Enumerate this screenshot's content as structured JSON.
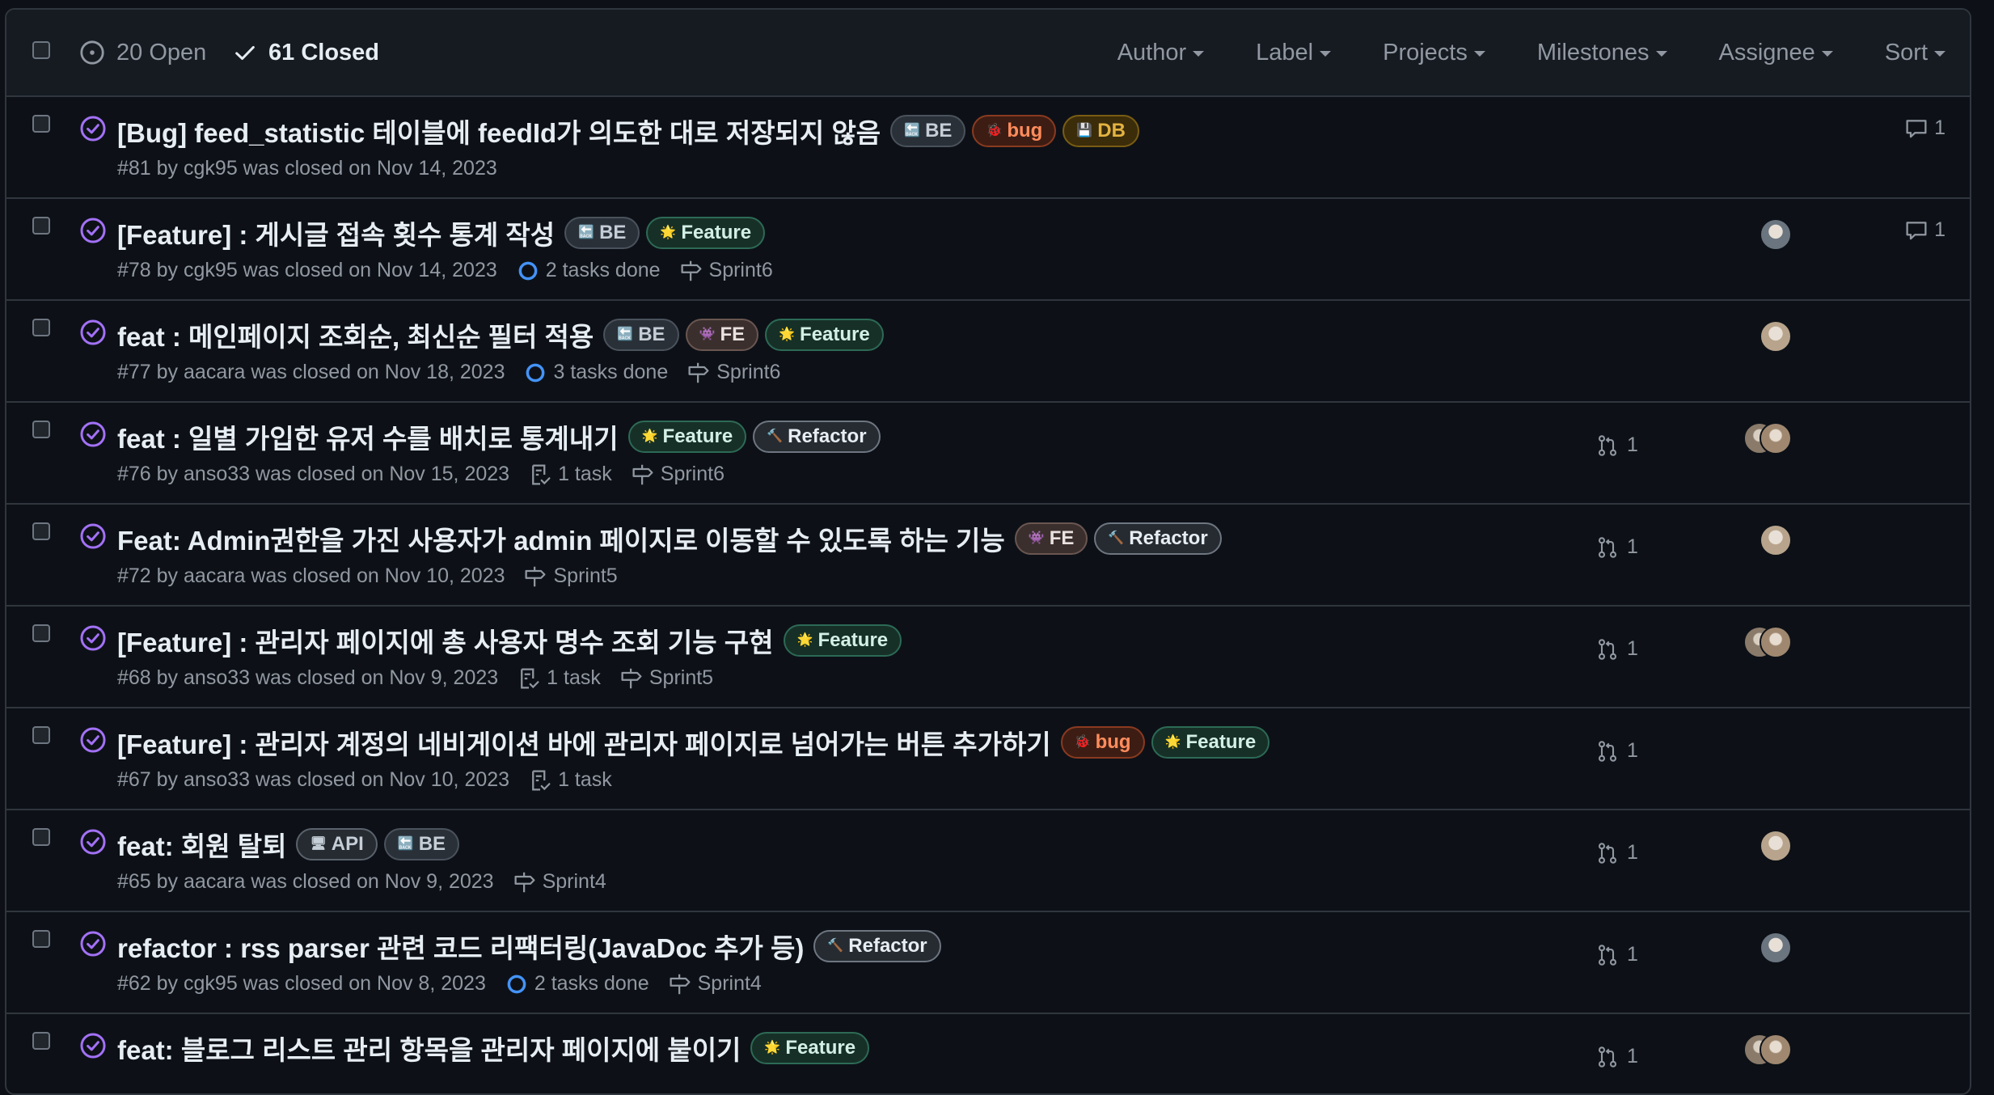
{
  "header": {
    "open_label": "20 Open",
    "closed_label": "61 Closed",
    "filters": [
      "Author",
      "Label",
      "Projects",
      "Milestones",
      "Assignee",
      "Sort"
    ]
  },
  "label_styles": {
    "BE": {
      "color": "#c5cdd6",
      "bg": "#2a3038",
      "border": "#4a525c",
      "icon": "🔙"
    },
    "FE": {
      "color": "#e9e2e0",
      "bg": "#3a2f2d",
      "border": "#6a5651",
      "icon": "👾"
    },
    "bug": {
      "color": "#ff8c5c",
      "bg": "#3d1d13",
      "border": "#8a3a20",
      "icon": "🐞"
    },
    "DB": {
      "color": "#e3b341",
      "bg": "#3b2c0a",
      "border": "#7a5d14",
      "icon": "💾"
    },
    "Feature": {
      "color": "#d3f0e6",
      "bg": "#173027",
      "border": "#2d6a55",
      "icon": "🌟"
    },
    "Refactor": {
      "color": "#e6edf3",
      "bg": "#262b31",
      "border": "#6e7681",
      "icon": "🔨"
    },
    "API": {
      "color": "#c5cdd6",
      "bg": "#262b31",
      "border": "#5a626c",
      "icon": "🖥"
    }
  },
  "issues": [
    {
      "title": "[Bug] feed_statistic 테이블에 feedId가 의도한 대로 저장되지 않음",
      "labels": [
        "BE",
        "bug",
        "DB"
      ],
      "meta": "#81 by cgk95 was closed on Nov 14, 2023",
      "tasks": "",
      "task_type": "",
      "milestone": "",
      "prs": "",
      "avatars": [],
      "comments": "1"
    },
    {
      "title": "[Feature] : 게시글 접속 횟수 통계 작성",
      "labels": [
        "BE",
        "Feature"
      ],
      "meta": "#78 by cgk95 was closed on Nov 14, 2023",
      "tasks": "2 tasks done",
      "task_type": "circle",
      "milestone": "Sprint6",
      "prs": "",
      "avatars": [
        "#6a7580"
      ],
      "comments": "1"
    },
    {
      "title": "feat : 메인페이지 조회순, 최신순 필터 적용",
      "labels": [
        "BE",
        "FE",
        "Feature"
      ],
      "meta": "#77 by aacara was closed on Nov 18, 2023",
      "tasks": "3 tasks done",
      "task_type": "circle",
      "milestone": "Sprint6",
      "prs": "",
      "avatars": [
        "#b8a48c"
      ],
      "comments": ""
    },
    {
      "title": "feat : 일별 가입한 유저 수를 배치로 통계내기",
      "labels": [
        "Feature",
        "Refactor"
      ],
      "meta": "#76 by anso33 was closed on Nov 15, 2023",
      "tasks": "1 task",
      "task_type": "list",
      "milestone": "Sprint6",
      "prs": "1",
      "avatars": [
        "#8a7a6a",
        "#a08870"
      ],
      "comments": ""
    },
    {
      "title": "Feat: Admin권한을 가진 사용자가 admin 페이지로 이동할 수 있도록 하는 기능",
      "labels": [
        "FE",
        "Refactor"
      ],
      "meta": "#72 by aacara was closed on Nov 10, 2023",
      "tasks": "",
      "task_type": "",
      "milestone": "Sprint5",
      "prs": "1",
      "avatars": [
        "#b8a48c"
      ],
      "comments": ""
    },
    {
      "title": "[Feature] : 관리자 페이지에 총 사용자 명수 조회 기능 구현",
      "labels": [
        "Feature"
      ],
      "meta": "#68 by anso33 was closed on Nov 9, 2023",
      "tasks": "1 task",
      "task_type": "list",
      "milestone": "Sprint5",
      "prs": "1",
      "avatars": [
        "#8a7a6a",
        "#a08870"
      ],
      "comments": ""
    },
    {
      "title": "[Feature] : 관리자 계정의 네비게이션 바에 관리자 페이지로 넘어가는 버튼 추가하기",
      "labels": [
        "bug",
        "Feature"
      ],
      "meta": "#67 by anso33 was closed on Nov 10, 2023",
      "tasks": "1 task",
      "task_type": "list",
      "milestone": "",
      "prs": "1",
      "avatars": [],
      "comments": ""
    },
    {
      "title": "feat: 회원 탈퇴",
      "labels": [
        "API",
        "BE"
      ],
      "meta": "#65 by aacara was closed on Nov 9, 2023",
      "tasks": "",
      "task_type": "",
      "milestone": "Sprint4",
      "prs": "1",
      "avatars": [
        "#b8a48c"
      ],
      "comments": ""
    },
    {
      "title": "refactor : rss parser 관련 코드 리팩터링(JavaDoc 추가 등)",
      "labels": [
        "Refactor"
      ],
      "meta": "#62 by cgk95 was closed on Nov 8, 2023",
      "tasks": "2 tasks done",
      "task_type": "circle",
      "milestone": "Sprint4",
      "prs": "1",
      "avatars": [
        "#6a7580"
      ],
      "comments": ""
    },
    {
      "title": "feat: 블로그 리스트 관리 항목을 관리자 페이지에 붙이기",
      "labels": [
        "Feature"
      ],
      "meta": "",
      "tasks": "",
      "task_type": "",
      "milestone": "",
      "prs": "1",
      "avatars": [
        "#8a7a6a",
        "#a08870"
      ],
      "comments": ""
    }
  ]
}
